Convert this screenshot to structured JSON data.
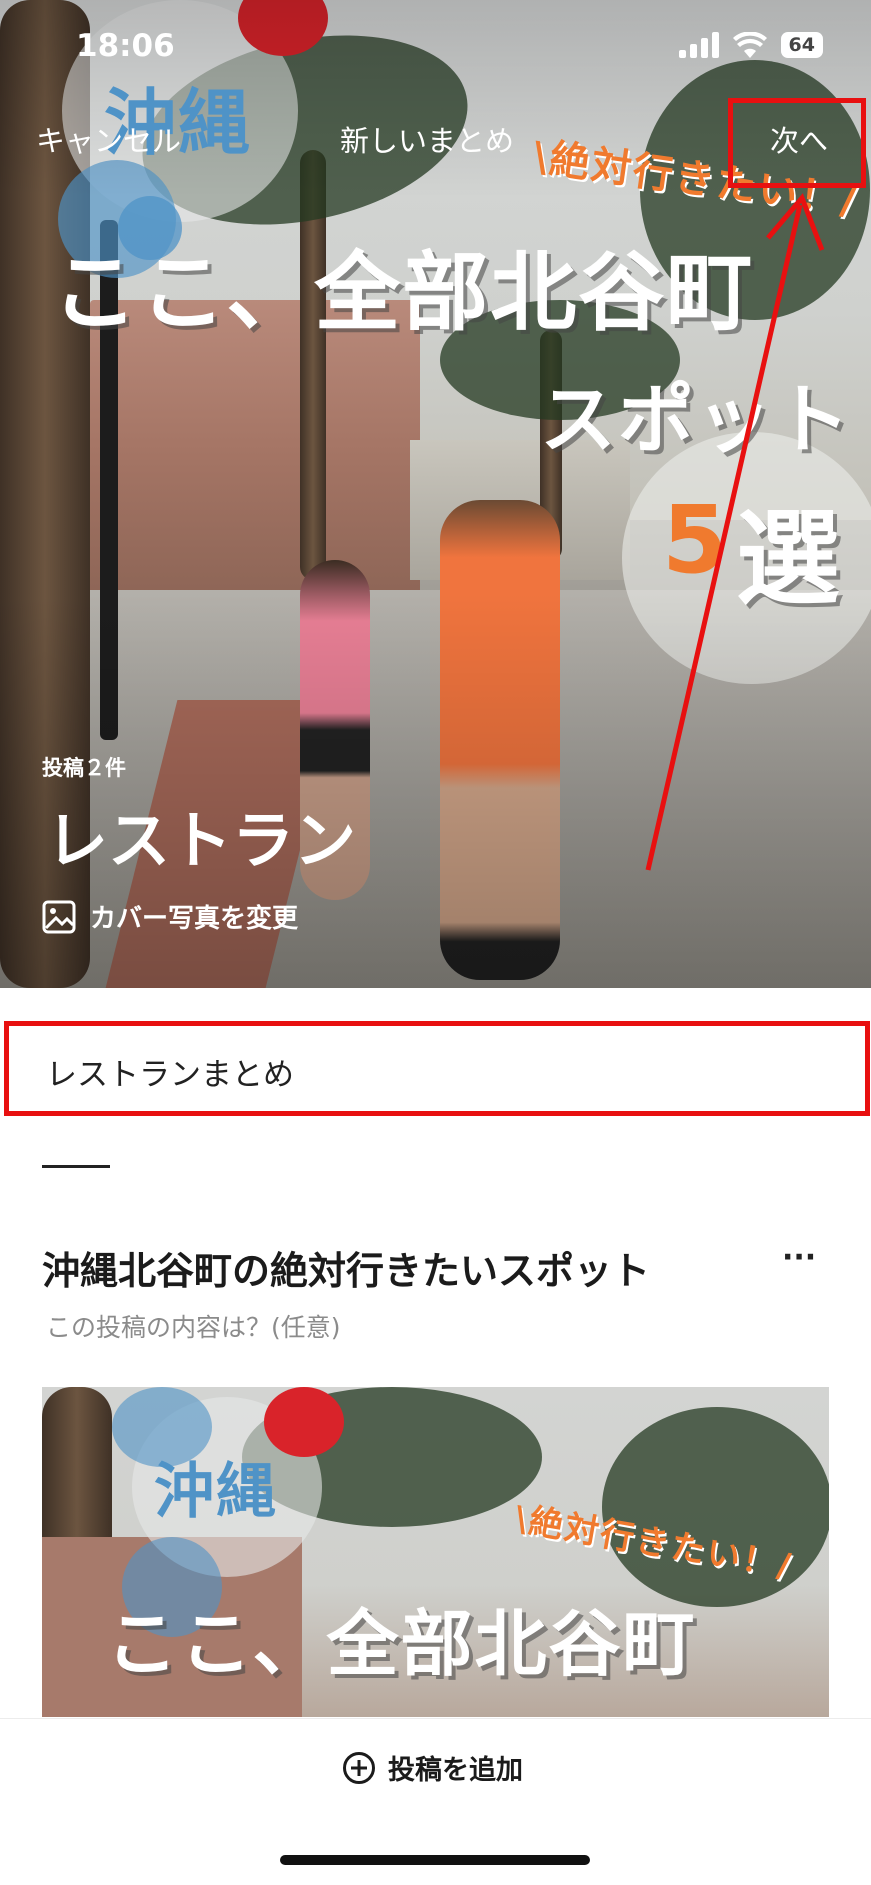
{
  "status_bar": {
    "time": "18:06",
    "battery": "64"
  },
  "nav": {
    "cancel_label": "キャンセル",
    "title": "新しいまとめ",
    "next_label": "次へ"
  },
  "cover": {
    "badge": "沖縄",
    "tagline": "\\絶対行きたい！/",
    "headline": "ここ、全部北谷町",
    "headline2": "スポット",
    "count_num": "5",
    "count_suffix": "選",
    "post_count": "投稿２件",
    "title": "レストラン",
    "change_cover_label": "カバー写真を変更"
  },
  "summary_title": {
    "value": "レストランまとめ"
  },
  "post": {
    "title": "沖縄北谷町の絶対行きたいスポット",
    "more_label": "···",
    "description_placeholder": "この投稿の内容は？(任意)",
    "thumb_badge": "沖縄",
    "thumb_tagline": "\\絶対行きたい！/",
    "thumb_headline": "ここ、全部北谷町"
  },
  "bottom": {
    "add_post_label": "投稿を追加"
  },
  "colors": {
    "highlight": "#e81010",
    "accent_orange": "#f07a2e",
    "bubble_blue": "#4f93c7"
  }
}
